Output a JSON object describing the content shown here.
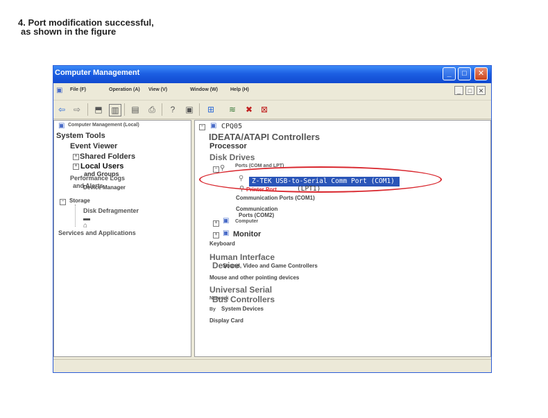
{
  "caption": {
    "line1": "4. Port modification successful,",
    "line2": "as shown in the figure"
  },
  "window": {
    "title": "Computer Management",
    "controls": [
      "_",
      "□",
      "✕"
    ]
  },
  "menu": {
    "items": [
      "File (F)",
      "Operation (A)",
      "View (V)",
      "Window (W)",
      "Help (H)"
    ]
  },
  "mdi_controls": [
    "_",
    "□",
    "✕"
  ],
  "left_tree": {
    "root": "Computer Management (Local)",
    "system_tools": "System Tools",
    "event_viewer": "Event Viewer",
    "shared_folders": "Shared Folders",
    "local_users_1": "Local Users",
    "local_users_2": "and Groups",
    "perf_logs_1": "Performance Logs",
    "perf_logs_2": "and Alerts",
    "device_manager": "Device Manager",
    "storage": "Storage",
    "disk_defrag": "Disk Defragmenter",
    "services": "Services and Applications"
  },
  "right_tree": {
    "root": "CPQ05",
    "ide": "IDEATA/ATAPI Controllers",
    "processor": "Processor",
    "disk_drives": "Disk Drives",
    "ports": "Ports (COM and LPT)",
    "selected_port": "Z-TEK USB-to-Serial Comm Port (COM1)",
    "printer_port": "Printer Port",
    "printer_port_suffix": "(LPT1)",
    "comm_port_com1": "Communication Ports (COM1)",
    "comm_port_com2_1": "Communication",
    "comm_port_com2_2": "Ports (COM2)",
    "computer": "Computer",
    "monitor": "Monitor",
    "keyboard": "Keyboard",
    "hid_1": "Human Interface",
    "hid_2": "Device",
    "sound": "Sound, Video and Game Controllers",
    "mouse": "Mouse and other pointing devices",
    "usb_1": "Universal Serial",
    "usb_2": "Bus Controllers",
    "network": "Network",
    "by": "By",
    "system_devices": "System Devices",
    "display_card": "Display Card"
  },
  "colors": {
    "titlebar": "#1c5fe3",
    "highlight_ellipse": "#d9272e",
    "selection": "#2a55b8"
  }
}
